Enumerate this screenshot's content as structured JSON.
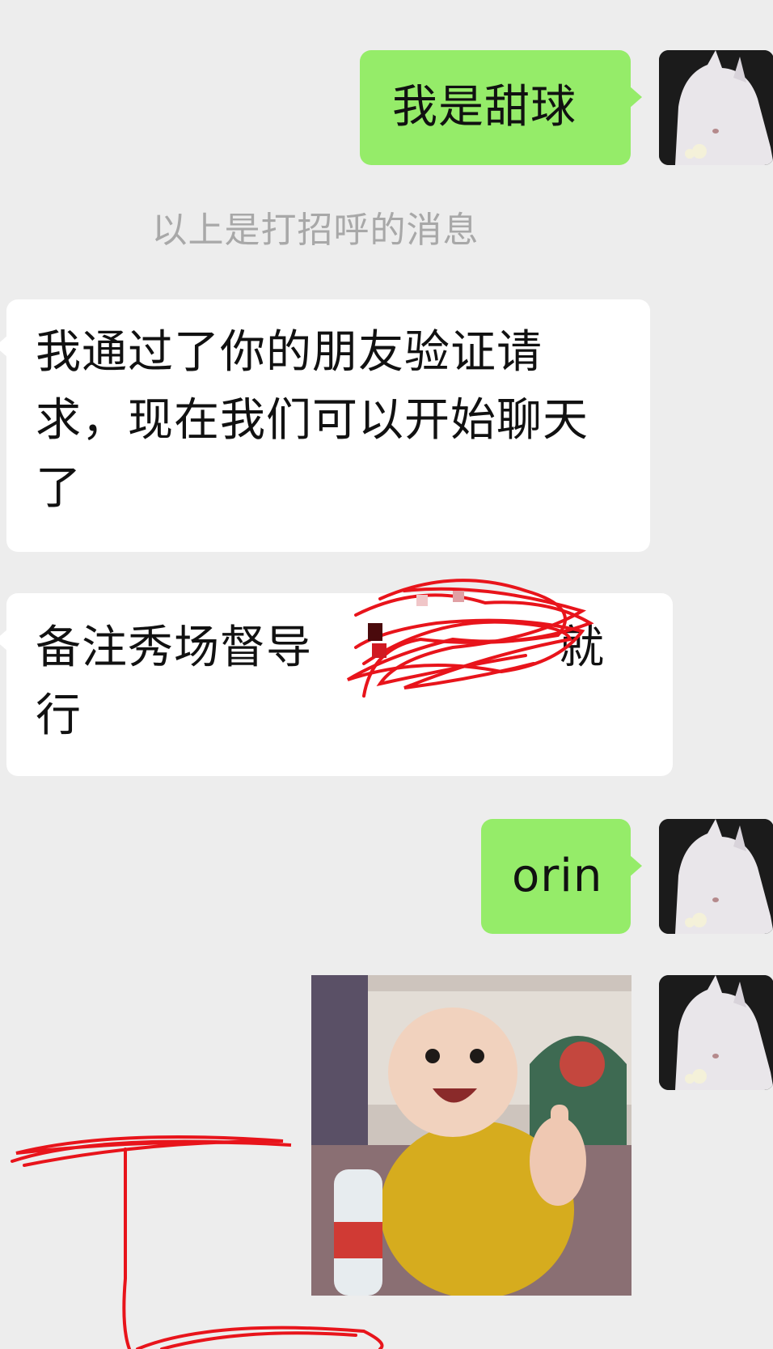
{
  "chat": {
    "messages": [
      {
        "side": "me",
        "type": "text",
        "text": "我是甜球",
        "avatar_icon": "white-horse-avatar-icon"
      },
      {
        "type": "system",
        "text": "以上是打招呼的消息"
      },
      {
        "side": "them",
        "type": "text",
        "text": "我通过了你的朋友验证请求，现在我们可以开始聊天了"
      },
      {
        "side": "them",
        "type": "text",
        "text_before_redaction": "备注秀场督导",
        "text_after_redaction": "就行",
        "redacted": true
      },
      {
        "side": "me",
        "type": "text",
        "text": "orin",
        "avatar_icon": "white-horse-avatar-icon"
      },
      {
        "side": "me",
        "type": "image",
        "description_icon": "baby-thumbs-up-sticker-icon",
        "avatar_icon": "white-horse-avatar-icon"
      }
    ]
  },
  "colors": {
    "background": "#ededed",
    "my_bubble": "#95ec69",
    "their_bubble": "#ffffff",
    "system_text": "#a8a8a8",
    "annotation_red": "#e8141b"
  }
}
